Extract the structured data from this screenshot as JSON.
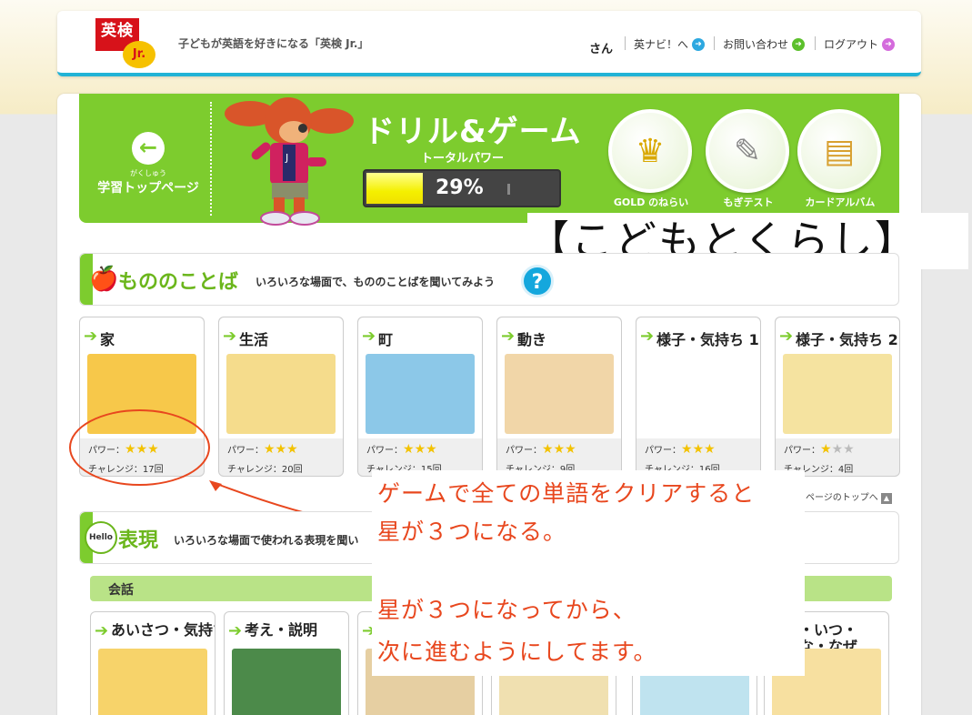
{
  "header": {
    "logo_text": "英検",
    "logo_badge": "Jr.",
    "tagline": "子どもが英語を好きになる「英検 Jr.」",
    "username_suffix": "さん",
    "nav": [
      {
        "label": "英ナビ！へ",
        "color": "#2da8e0"
      },
      {
        "label": "お問い合わせ",
        "color": "#5cc02c"
      },
      {
        "label": "ログアウト",
        "color": "#d46bdc"
      }
    ]
  },
  "banner": {
    "back_ruby": "がくしゅう",
    "back_label": "学習トップページ",
    "title": "ドリル&ゲーム",
    "total_power_label": "トータルパワー",
    "total_power_percent": "29%",
    "total_power_value": 29,
    "buttons": [
      {
        "label": "GOLD のねらい",
        "icon": "crown-icon",
        "glyph": "♛"
      },
      {
        "label": "もぎテスト",
        "icon": "test-mouse-icon",
        "glyph": "🖱"
      },
      {
        "label": "カードアルバム",
        "icon": "card-album-icon",
        "glyph": "🃏"
      }
    ]
  },
  "annotation_title": "【こどもとくらし】",
  "section1": {
    "title": "もののことば",
    "description": "いろいろな場面で、もののことばを聞いてみよう",
    "help": "?",
    "cards": [
      {
        "title": "家",
        "power_label": "パワー：",
        "stars": 3,
        "challenge": "チャレンジ：17回",
        "art": "#f7c84a"
      },
      {
        "title": "生活",
        "power_label": "パワー：",
        "stars": 3,
        "challenge": "チャレンジ：20回",
        "art": "#f5dc8c"
      },
      {
        "title": "町",
        "power_label": "パワー：",
        "stars": 3,
        "challenge": "チャレンジ：15回",
        "art": "#8cc8e8"
      },
      {
        "title": "動き",
        "power_label": "パワー：",
        "stars": 3,
        "challenge": "チャレンジ：9回",
        "art": "#f1d6a8"
      },
      {
        "title": "様子・気持ち 1",
        "power_label": "パワー：",
        "stars": 3,
        "challenge": "チャレンジ：16回",
        "art": "#ffffff"
      },
      {
        "title": "様子・気持ち 2",
        "power_label": "パワー：",
        "stars": 1,
        "challenge": "チャレンジ：4回",
        "art": "#f5e3a0"
      }
    ]
  },
  "annotation_note": {
    "line1": "ゲームで全ての単語をクリアすると",
    "line2": "星が３つになる。",
    "line3": "星が３つになってから、",
    "line4": "次に進むようにしてます。"
  },
  "page_top": "ページのトップへ",
  "section2": {
    "icon_text": "Hello",
    "title": "表現",
    "description": "いろいろな場面で使われる表現を聞い",
    "subsection": "会話",
    "cards": [
      {
        "title": "あいさつ・気持ち",
        "art": "#f7d36a"
      },
      {
        "title": "考え・説明",
        "art": "#4c8a4a"
      },
      {
        "title": "",
        "art": "#e6cfa2"
      },
      {
        "title": "",
        "art": "#f0e0b0"
      },
      {
        "title": "",
        "art": "#bfe3ef"
      },
      {
        "title": "こ・いつ・\nんな・なぜ",
        "art": "#f7e0a0"
      }
    ]
  }
}
